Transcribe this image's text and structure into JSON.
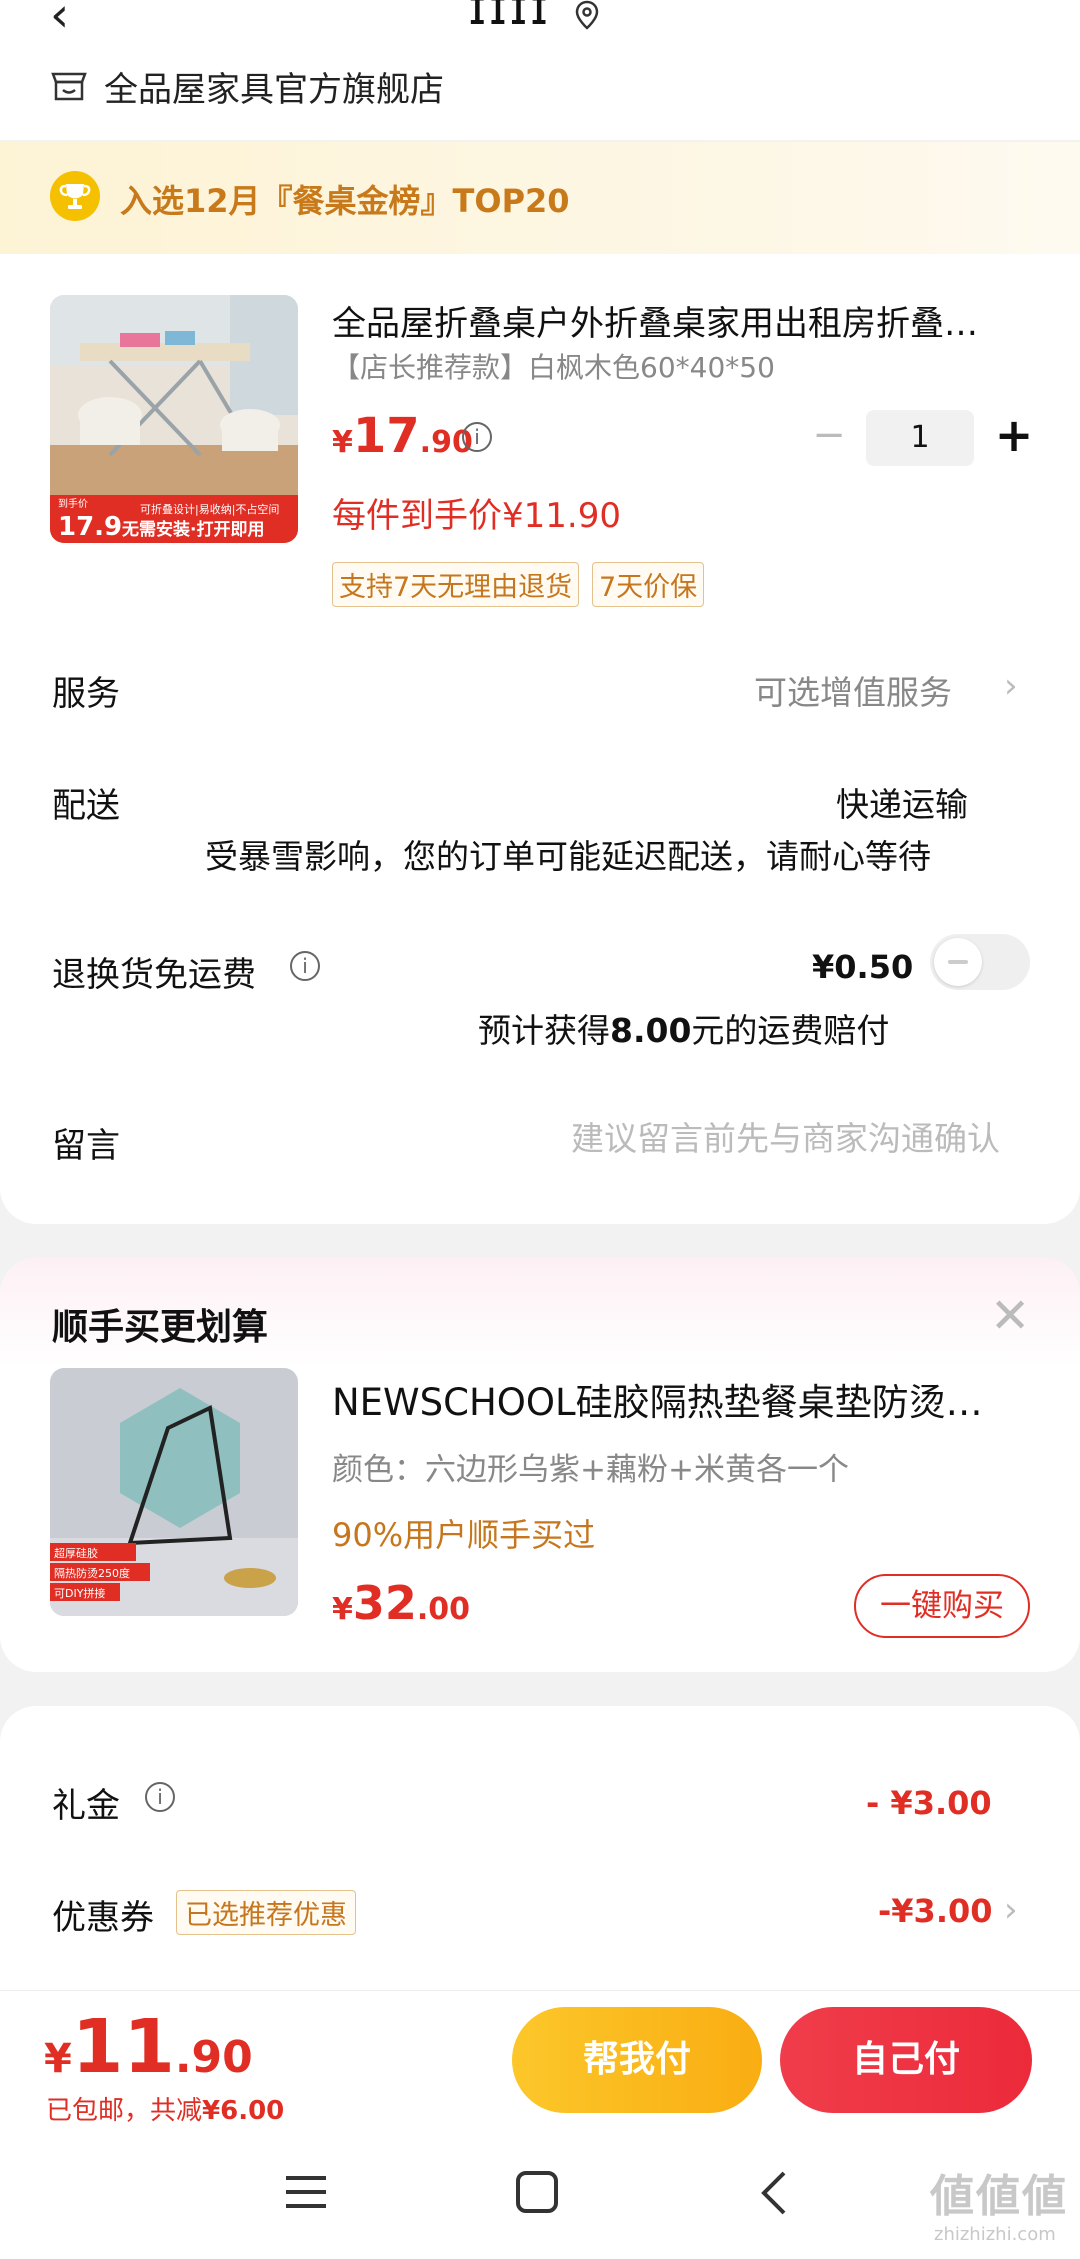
{
  "top_bar": {
    "back_icon": "back-arrow-icon",
    "title": "ɪɪɪɪ",
    "location_icon": "location-pin-icon",
    "store_name": "全品屋家具官方旗舰店"
  },
  "rank_banner": {
    "icon": "trophy-icon",
    "text": "入选12月『餐桌金榜』TOP20"
  },
  "product": {
    "title": "全品屋折叠桌户外折叠桌家用出租房折叠…",
    "spec": "【店长推荐款】白枫木色60*40*50",
    "price_currency": "¥",
    "price_int": "17",
    "price_dec": ".90",
    "per_item_price": "每件到手价¥11.90",
    "tags": [
      "支持7天无理由退货",
      "7天价保"
    ],
    "quantity": "1",
    "image_overlay": {
      "badge_price": "17.9",
      "badge_small": "到手价",
      "sub_text": "可折叠设计|易收纳|不占空间",
      "slogan": "无需安装·打开即用"
    }
  },
  "service": {
    "label": "服务",
    "value": "可选增值服务",
    "chevron": "›"
  },
  "delivery": {
    "label": "配送",
    "value": "快递运输",
    "note": "受暴雪影响，您的订单可能延迟配送，请耐心等待"
  },
  "return_shipping": {
    "label": "退换货免运费",
    "price": "¥0.50",
    "note_prefix": "预计获得",
    "note_amount": "8.00",
    "note_suffix": "元的运费赔付",
    "toggle_on": false
  },
  "message": {
    "label": "留言",
    "placeholder": "建议留言前先与商家沟通确认"
  },
  "addon": {
    "title": "顺手买更划算",
    "close": "✕",
    "name": "NEWSCHOOL硅胶隔热垫餐桌垫防烫…",
    "color": "颜色：六边形乌紫+藕粉+米黄各一个",
    "bought": "90%用户顺手买过",
    "price_currency": "¥",
    "price_int": "32",
    "price_dec": ".00",
    "buy_label": "一键购买",
    "image_overlay": [
      "超厚硅胶",
      "隔热防烫250度",
      "可DIY拼接"
    ]
  },
  "discounts": {
    "gift_label": "礼金",
    "gift_value": "- ¥3.00",
    "coupon_label": "优惠券",
    "coupon_tag": "已选推荐优惠",
    "coupon_value": "-¥3.00",
    "chevron": "›"
  },
  "bottom": {
    "total_currency": "¥",
    "total_int": "11",
    "total_dec": ".90",
    "note_prefix": "已包邮，共减",
    "note_amount": "¥6.00",
    "help_pay": "帮我付",
    "self_pay": "自己付"
  },
  "colors": {
    "accent_red": "#e02e24",
    "gold": "#c6761c",
    "yellow_button": "#fcc72a",
    "red_button": "#ec2a3a"
  },
  "watermark": {
    "main": "値値値",
    "sub": "zhizhizhi.com"
  }
}
